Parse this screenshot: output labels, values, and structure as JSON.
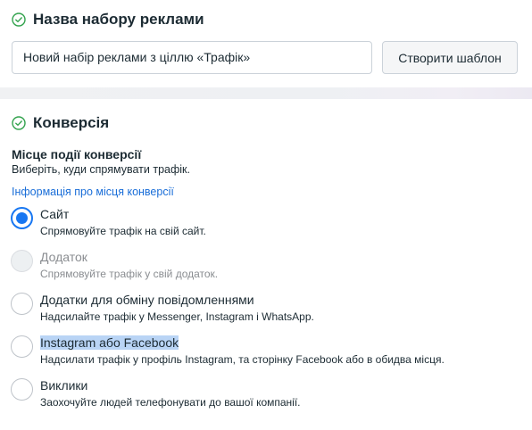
{
  "name_section": {
    "title": "Назва набору реклами",
    "icon": "check-circle-icon",
    "input_value": "Новий набір реклами з ціллю «Трафік»",
    "template_button": "Створити шаблон"
  },
  "conversion_section": {
    "title": "Конверсія",
    "icon": "check-circle-icon",
    "destination_title": "Місце події конверсії",
    "destination_subtitle": "Виберіть, куди спрямувати трафік.",
    "info_link": "Інформація про місця конверсії",
    "options": [
      {
        "label": "Сайт",
        "description": "Спрямовуйте трафік на свій сайт.",
        "state": "selected"
      },
      {
        "label": "Додаток",
        "description": "Спрямовуйте трафік у свій додаток.",
        "state": "disabled"
      },
      {
        "label": "Додатки для обміну повідомленнями",
        "description": "Надсилайте трафік у Messenger, Instagram і WhatsApp.",
        "state": "unselected"
      },
      {
        "label": "Instagram або Facebook",
        "description": "Надсилати трафік у профіль Instagram, та сторінку Facebook або в обидва місця.",
        "state": "unselected"
      },
      {
        "label": "Виклики",
        "description": "Заохочуйте людей телефонувати до вашої компанії.",
        "state": "unselected"
      }
    ]
  },
  "colors": {
    "accent": "#1877f2",
    "success": "#31a24c",
    "link": "#1a6ed8"
  }
}
